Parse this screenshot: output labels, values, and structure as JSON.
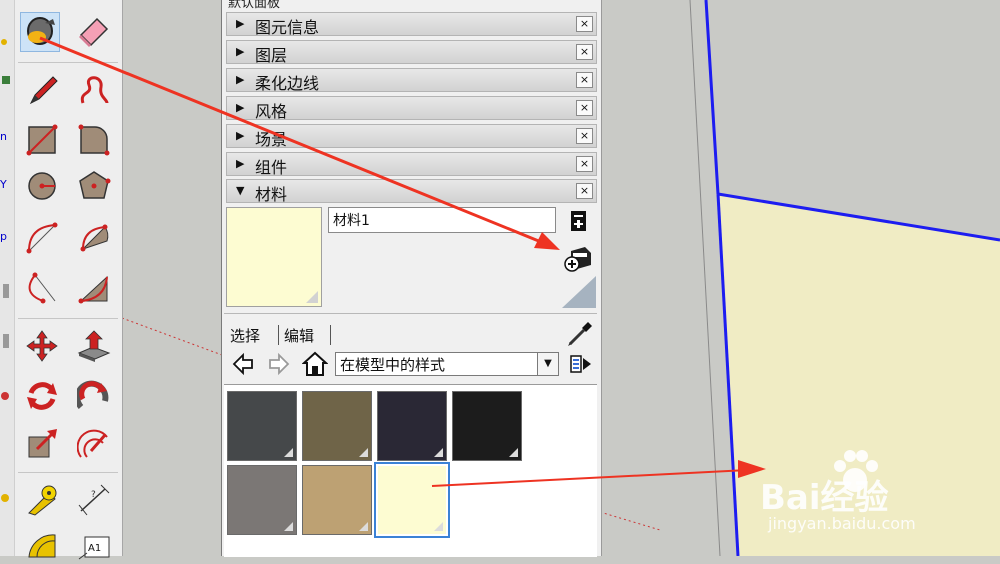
{
  "tray": {
    "title": "默认面板",
    "panels": [
      {
        "label": "图元信息",
        "collapsed": true
      },
      {
        "label": "图层",
        "collapsed": true
      },
      {
        "label": "柔化边线",
        "collapsed": true
      },
      {
        "label": "风格",
        "collapsed": true
      },
      {
        "label": "场景",
        "collapsed": true
      },
      {
        "label": "组件",
        "collapsed": true
      },
      {
        "label": "材料",
        "collapsed": false
      }
    ],
    "close_glyph": "×",
    "expand_glyph": "▶",
    "collapse_glyph": "▼"
  },
  "materials": {
    "name_value": "材料1",
    "tabs": [
      "选择",
      "编辑"
    ],
    "collection_selected": "在模型中的样式",
    "preview_color": "#fdfcd2",
    "swatches": [
      {
        "color": "#45484a"
      },
      {
        "color": "#6f6448"
      },
      {
        "color": "#2a2835"
      },
      {
        "color": "#1c1c1c"
      },
      {
        "color": "#7b7775"
      },
      {
        "color": "#bda173"
      },
      {
        "color": "#fdfcd2",
        "selected": true
      }
    ]
  },
  "watermark": {
    "brand": "Bai经验",
    "url": "jingyan.baidu.com"
  },
  "colors": {
    "accent_selection": "#3b82d6",
    "edge_blue": "#1d1df0",
    "face_fill": "#f0ecc4",
    "arrow_red": "#ee3322"
  }
}
